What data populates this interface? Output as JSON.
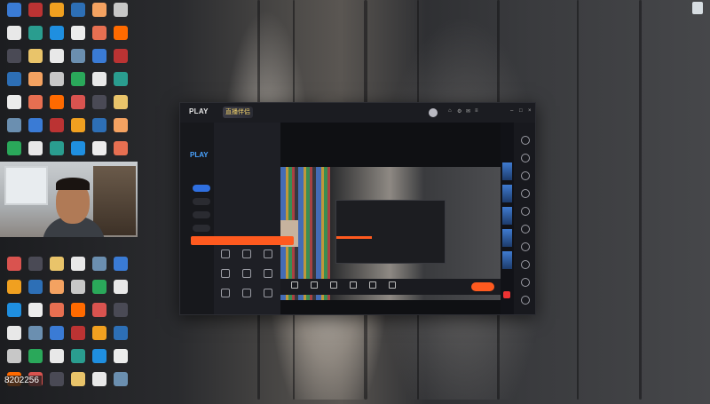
{
  "desktop": {
    "icon_colors": [
      "#3a7bd5",
      "#e8e8e8",
      "#4a4a55",
      "#2d6fb6",
      "#ececec",
      "#6b8fb0",
      "#2aa85a",
      "#d9534f",
      "#f0a020",
      "#1f8fe0",
      "#e8e8e8",
      "#c7c7c7",
      "#ff6a00",
      "#b33",
      "#2a9d8f",
      "#e9c46a",
      "#f4a261",
      "#e76f51"
    ],
    "recycle_label": "",
    "counter_text": "8202256"
  },
  "app": {
    "logo_text": "PLAY",
    "brand_text": "直播伴侣",
    "version": "",
    "nav_items": [
      "",
      "",
      "",
      "",
      ""
    ],
    "username": "",
    "play_label": "PLAY",
    "panel_tabs": [
      "",
      "",
      ""
    ],
    "scenes": [
      "",
      ""
    ],
    "tooltip": "",
    "tools": [
      "",
      "",
      "",
      "",
      "",
      "",
      "",
      "",
      ""
    ],
    "preview_title": "",
    "preview_badges": [
      "",
      "",
      ""
    ],
    "bottom_tools": [
      "",
      "",
      "",
      "",
      "",
      ""
    ],
    "golive_label": ""
  }
}
